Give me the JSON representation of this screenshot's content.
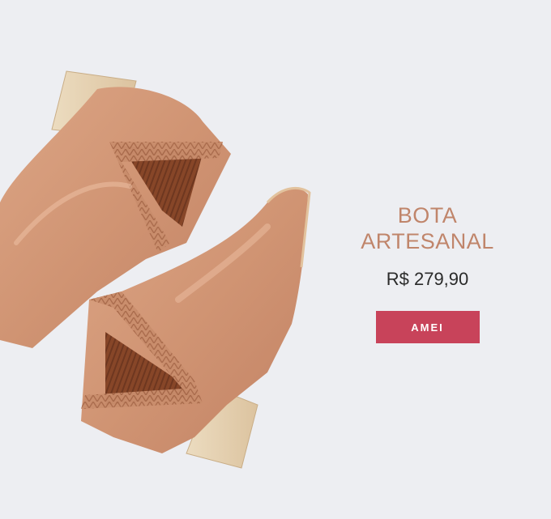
{
  "product": {
    "title_line1": "BOTA",
    "title_line2": "ARTESANAL",
    "price": "R$ 279,90",
    "cta_label": "AMEI"
  },
  "colors": {
    "background": "#edeef2",
    "title": "#c0856b",
    "price": "#2a2a2a",
    "cta_background": "#c8435a",
    "leather": "#d29a78",
    "heel_wood": "#e8d3b3",
    "elastic": "#8a4a2e"
  }
}
